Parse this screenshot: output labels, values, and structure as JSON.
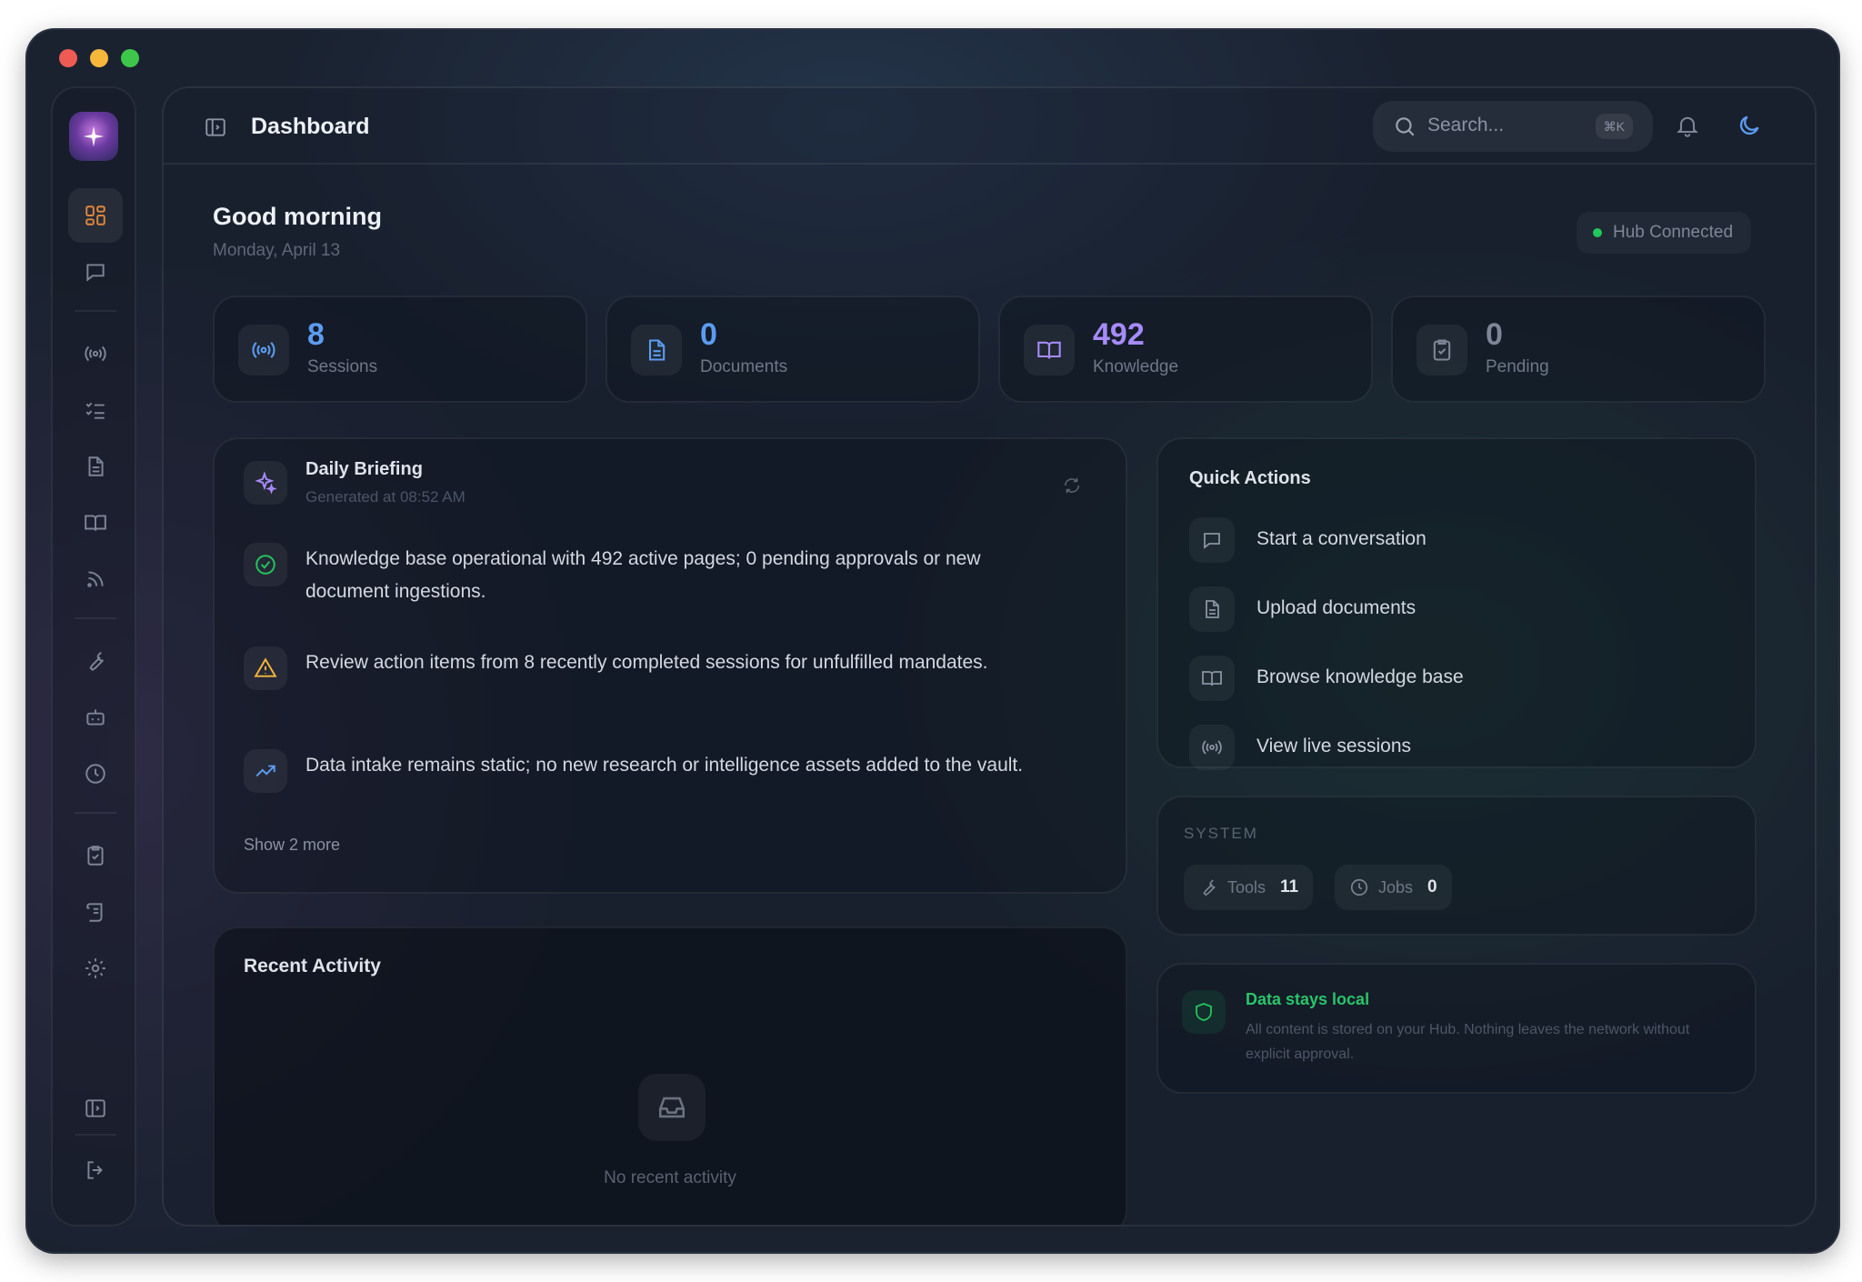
{
  "header": {
    "title": "Dashboard",
    "search_placeholder": "Search...",
    "search_shortcut": "⌘K"
  },
  "greeting": {
    "title": "Good morning",
    "date": "Monday, April 13",
    "status": "Hub Connected",
    "status_color": "#22c55e"
  },
  "stats": [
    {
      "value": "8",
      "label": "Sessions",
      "icon": "broadcast-icon",
      "color": "#5b9cf0"
    },
    {
      "value": "0",
      "label": "Documents",
      "icon": "document-icon",
      "color": "#5b9cf0"
    },
    {
      "value": "492",
      "label": "Knowledge",
      "icon": "book-icon",
      "color": "#a78bfa"
    },
    {
      "value": "0",
      "label": "Pending",
      "icon": "clipboard-check-icon",
      "color": "#7d8596"
    }
  ],
  "briefing": {
    "title": "Daily Briefing",
    "subtitle": "Generated at 08:52 AM",
    "items": [
      {
        "icon": "check-circle-icon",
        "color": "#22c55e",
        "text": "Knowledge base operational with 492 active pages; 0 pending approvals or new document ingestions."
      },
      {
        "icon": "warning-icon",
        "color": "#f5b83a",
        "text": "Review action items from 8 recently completed sessions for unfulfilled mandates."
      },
      {
        "icon": "trend-up-icon",
        "color": "#5b9cf0",
        "text": "Data intake remains static; no new research or intelligence assets added to the vault."
      }
    ],
    "show_more": "Show 2 more"
  },
  "recent": {
    "title": "Recent Activity",
    "empty": "No recent activity"
  },
  "quick_actions": {
    "title": "Quick Actions",
    "items": [
      {
        "label": "Start a conversation",
        "icon": "chat-icon"
      },
      {
        "label": "Upload documents",
        "icon": "document-icon"
      },
      {
        "label": "Browse knowledge base",
        "icon": "book-icon"
      },
      {
        "label": "View live sessions",
        "icon": "broadcast-icon"
      }
    ]
  },
  "system": {
    "label": "SYSTEM",
    "tools_label": "Tools",
    "tools_value": "11",
    "jobs_label": "Jobs",
    "jobs_value": "0"
  },
  "privacy": {
    "title": "Data stays local",
    "text": "All content is stored on your Hub. Nothing leaves the network without explicit approval."
  },
  "colors": {
    "accent_active": "#e0873a",
    "accent_blue": "#5b9cf0",
    "accent_purple": "#a78bfa",
    "success": "#22c55e",
    "warning": "#f5b83a"
  }
}
